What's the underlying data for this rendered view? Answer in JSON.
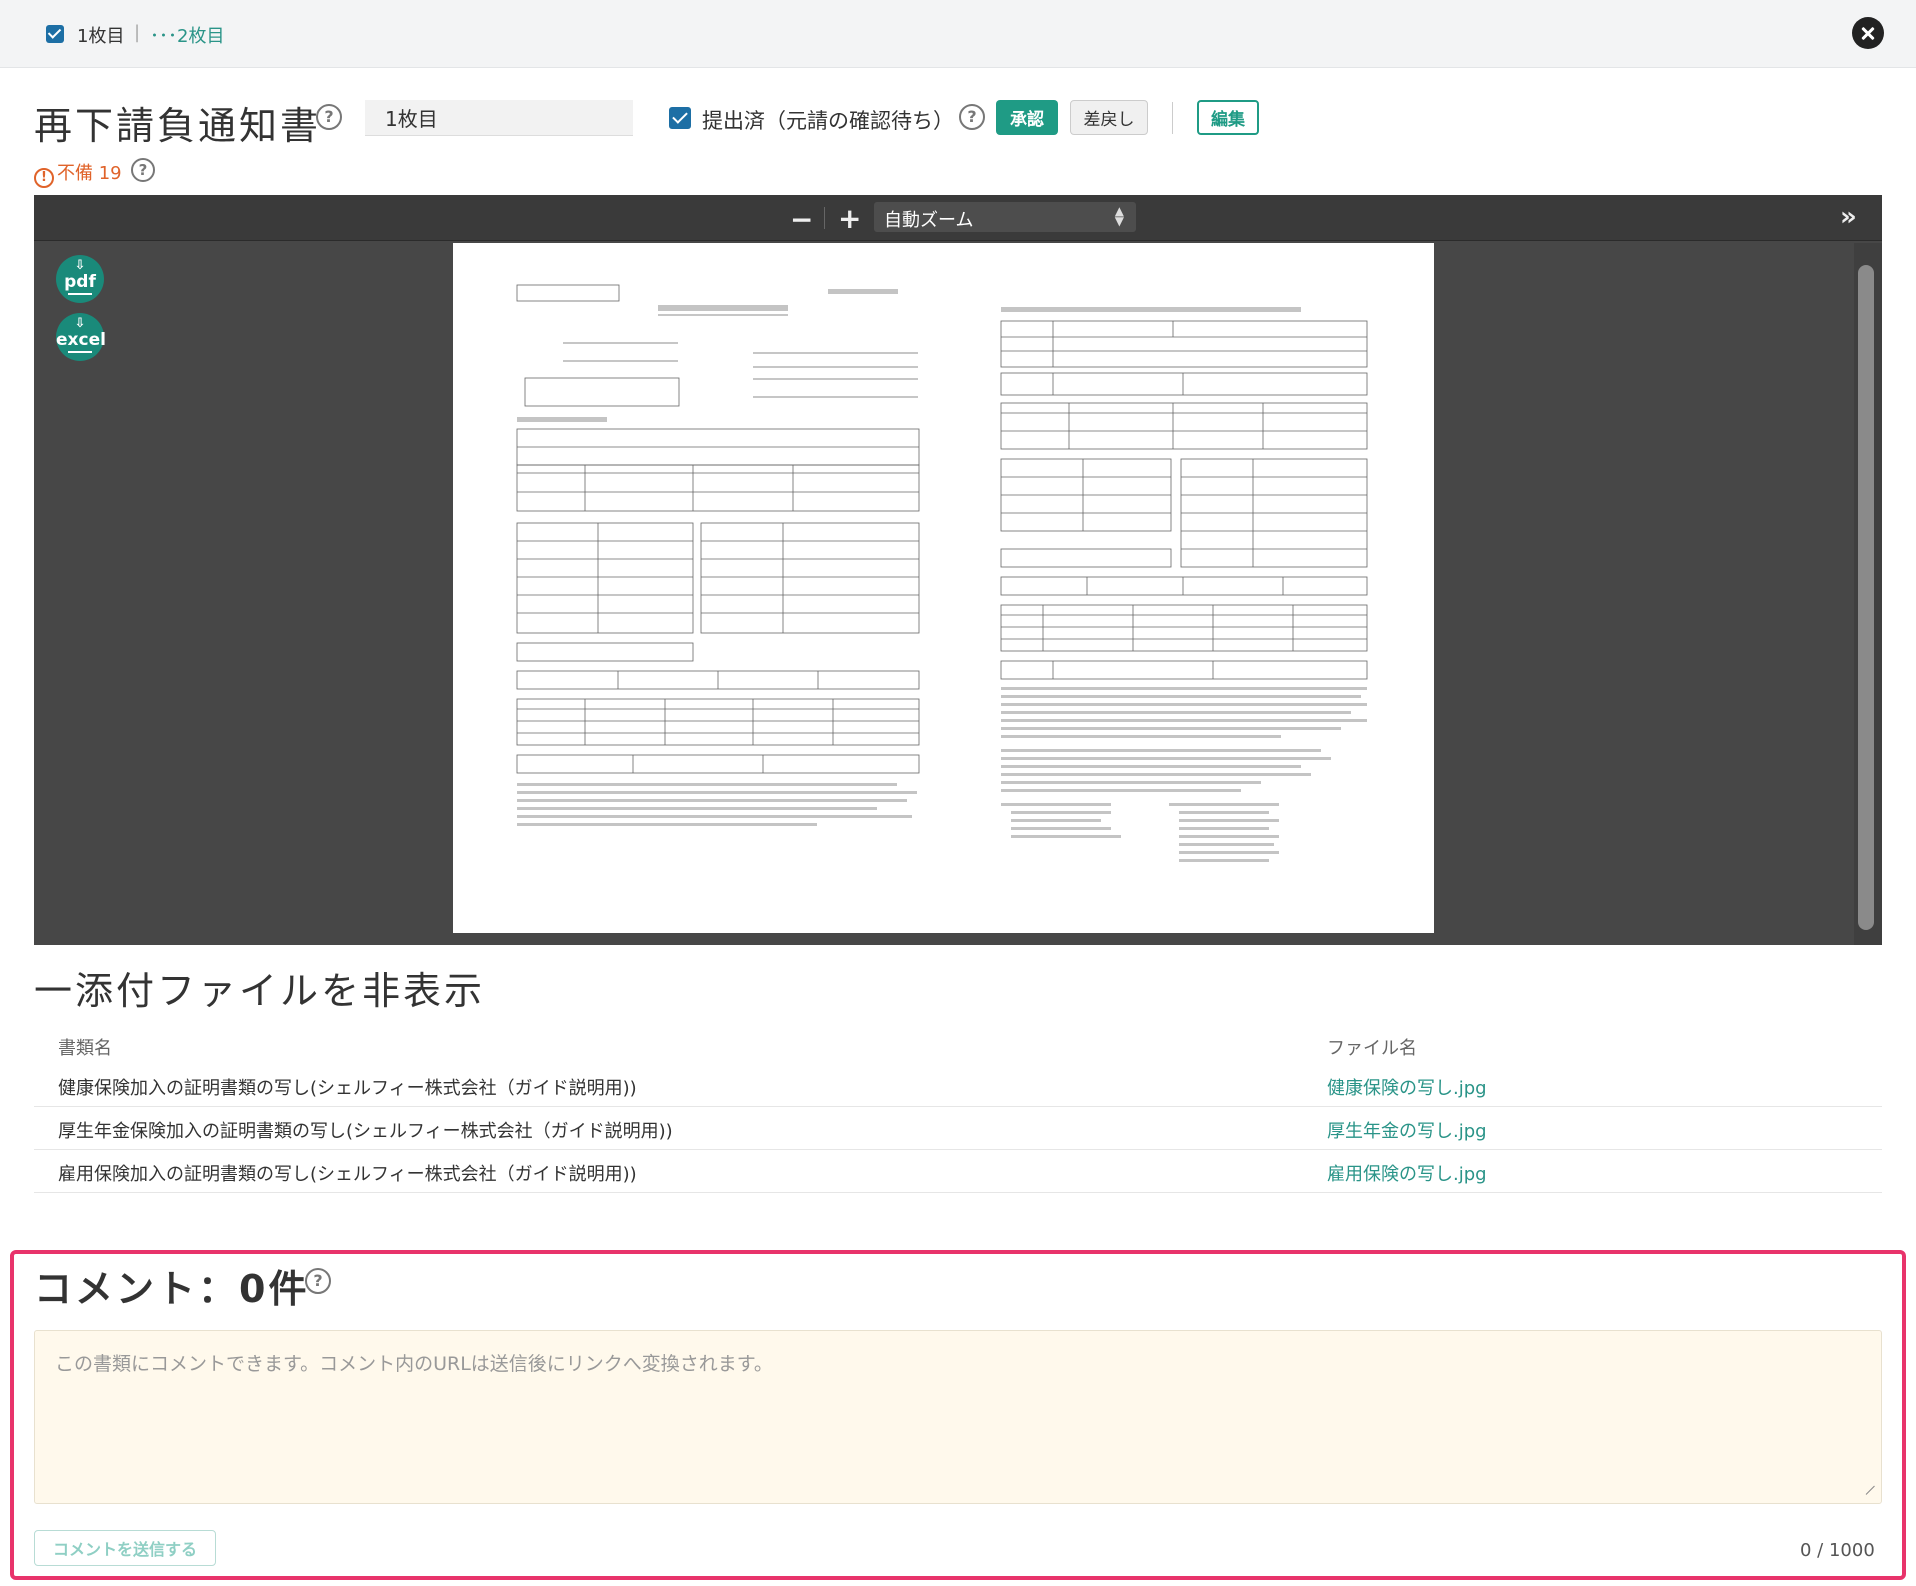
{
  "topbar": {
    "tab1_label": "1枚目",
    "separator": "|",
    "tab2_label": "･･･2枚目"
  },
  "header": {
    "title": "再下請負通知書",
    "help_glyph": "?",
    "sheet_name_value": "1枚目",
    "submitted_label": "提出済（元請の確認待ち）",
    "approve_label": "承認",
    "return_label": "差戻し",
    "edit_label": "編集"
  },
  "warning": {
    "icon": "!",
    "text": "不備 19"
  },
  "viewer": {
    "zoom_out": "−",
    "zoom_in": "+",
    "zoom_select": "自動ズーム",
    "sidebar_toggle": "»",
    "pdf_label": "pdf",
    "excel_label": "excel",
    "download_arrow": "⇩"
  },
  "attachments": {
    "title": "一添付ファイルを非表示",
    "col_doc": "書類名",
    "col_file": "ファイル名",
    "rows": [
      {
        "doc": "健康保険加入の証明書類の写し(シェルフィー株式会社（ガイド説明用))",
        "file": "健康保険の写し.jpg"
      },
      {
        "doc": "厚生年金保険加入の証明書類の写し(シェルフィー株式会社（ガイド説明用))",
        "file": "厚生年金の写し.jpg"
      },
      {
        "doc": "雇用保険加入の証明書類の写し(シェルフィー株式会社（ガイド説明用))",
        "file": "雇用保険の写し.jpg"
      }
    ]
  },
  "comments": {
    "title": "コメント：0件",
    "placeholder": "この書類にコメントできます。コメント内のURLは送信後にリンクへ変換されます。",
    "send_label": "コメントを送信する",
    "counter": "0 / 1000"
  },
  "colors": {
    "accent": "#1f9b85",
    "link": "#2a9488",
    "warning": "#e0632a",
    "highlight": "#e8336b"
  }
}
